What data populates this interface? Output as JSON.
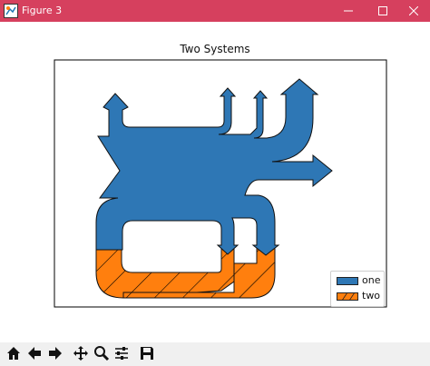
{
  "window": {
    "title": "Figure 3",
    "titlebar_color": "#d6405e",
    "controls": [
      "minimize-icon",
      "maximize-icon",
      "close-icon"
    ]
  },
  "chart_data": {
    "type": "sankey",
    "title": "Two Systems",
    "legend": {
      "position": "lower-right",
      "entries": [
        "one",
        "two"
      ]
    },
    "series": [
      {
        "name": "one",
        "color": "#2e77b5",
        "hatch": "none"
      },
      {
        "name": "two",
        "color": "#ff7f0e",
        "hatch": "diagonal"
      }
    ],
    "axes_visible": false
  },
  "toolbar": {
    "buttons": [
      "home-icon",
      "back-arrow-icon",
      "forward-arrow-icon",
      "pan-icon",
      "zoom-icon",
      "configure-subplots-icon",
      "save-icon"
    ]
  }
}
